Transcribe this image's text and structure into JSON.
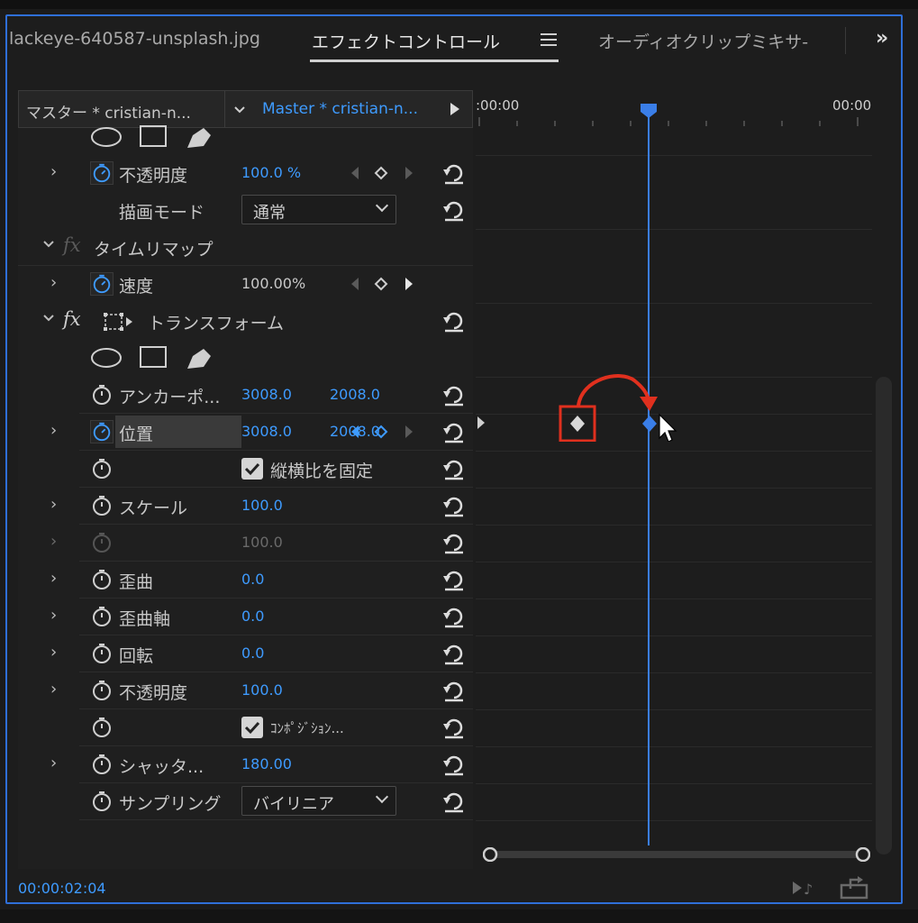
{
  "tabs": {
    "source_tab": "lackeye-640587-unsplash.jpg",
    "effect_controls": "エフェクトコントロール",
    "audio_mixer": "オーディオクリップミキサ-"
  },
  "header": {
    "master_label": "マスター * cristian-n...",
    "clip_label": "Master * cristian-n..."
  },
  "ruler": {
    "start": ":00:00",
    "end": "00:00"
  },
  "rows": {
    "opacity1_label": "不透明度",
    "opacity1_value": "100.0 %",
    "blend_label": "描画モード",
    "blend_value": "通常",
    "timeremap_label": "タイムリマップ",
    "speed_label": "速度",
    "speed_value": "100.00%",
    "transform_label": "トランスフォーム",
    "anchor_label": "アンカーポ...",
    "anchor_x": "3008.0",
    "anchor_y": "2008.0",
    "position_label": "位置",
    "position_x": "3008.0",
    "position_y": "2008.0",
    "uniform_label": "縦横比を固定",
    "scale_label": "スケール",
    "scale_value": "100.0",
    "scale2_value": "100.0",
    "skew_label": "歪曲",
    "skew_value": "0.0",
    "skew_axis_label": "歪曲軸",
    "skew_axis_value": "0.0",
    "rotation_label": "回転",
    "rotation_value": "0.0",
    "opacity2_label": "不透明度",
    "opacity2_value": "100.0",
    "composition_label": "ｺﾝﾎﾟｼﾞｼｮﾝ...",
    "shutter_label": "シャッタ...",
    "shutter_value": "180.00",
    "sampling_label": "サンプリング",
    "sampling_value": "バイリニア"
  },
  "timecode": "00:00:02:04",
  "colors": {
    "accent_blue": "#3e9bff",
    "panel_border": "#2f6fd8",
    "annotation_red": "#e0301e"
  }
}
